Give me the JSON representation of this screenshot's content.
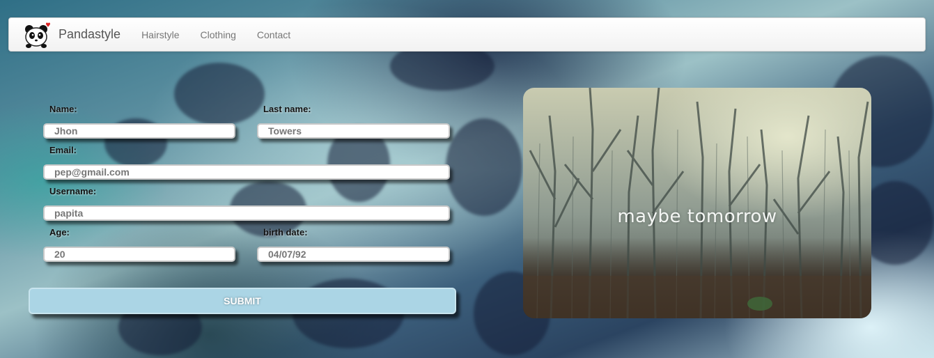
{
  "navbar": {
    "brand": "Pandastyle",
    "items": [
      {
        "label": "Hairstyle"
      },
      {
        "label": "Clothing"
      },
      {
        "label": "Contact"
      }
    ]
  },
  "form": {
    "name": {
      "label": "Name:",
      "value": "Jhon"
    },
    "last_name": {
      "label": "Last name:",
      "value": "Towers"
    },
    "email": {
      "label": "Email:",
      "value": "pep@gmail.com"
    },
    "username": {
      "label": "Username:",
      "value": "papita"
    },
    "age": {
      "label": "Age:",
      "value": "20"
    },
    "birth_date": {
      "label": "birth date:",
      "value": "04/07/92"
    },
    "submit_label": "SUBMIT"
  },
  "photo": {
    "caption": "maybe tomorrow"
  },
  "colors": {
    "submit_bg": "#abd5e5",
    "navbar_bg": "#ffffff"
  }
}
